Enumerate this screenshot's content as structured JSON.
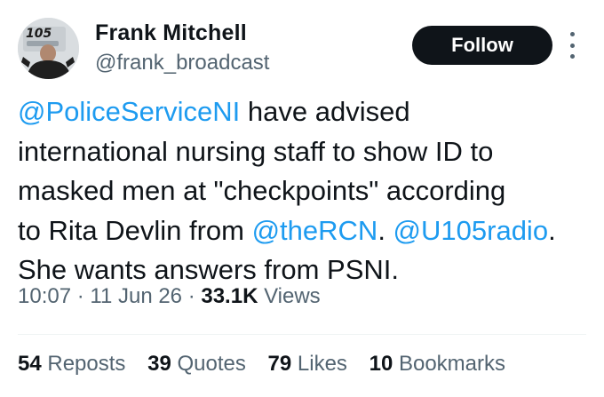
{
  "author": {
    "name": "Frank Mitchell",
    "handle": "@frank_broadcast",
    "avatar_logo_text": "105"
  },
  "follow_label": "Follow",
  "tweet": {
    "line1": {
      "mention": "@PoliceServiceNI",
      "text": " have advised"
    },
    "line2": "international nursing staff to show ID to",
    "line3": "masked men at \"checkpoints\" according",
    "line4": {
      "text": "to Rita Devlin from ",
      "mention1": "@theRCN",
      "sep": ". ",
      "mention2": "@U105radio",
      "end": "."
    },
    "line5": "She wants answers from PSNI."
  },
  "meta": {
    "time": "10:07",
    "sep1": " · ",
    "date": "11 Jun 26",
    "sep2": " · ",
    "views_count": "33.1K",
    "views_label": " Views"
  },
  "stats": {
    "reposts_count": "54",
    "reposts_label": " Reposts",
    "quotes_count": "39",
    "quotes_label": " Quotes",
    "likes_count": "79",
    "likes_label": " Likes",
    "bookmarks_count": "10",
    "bookmarks_label": " Bookmarks"
  },
  "colors": {
    "link": "#1d9bf0",
    "text_primary": "#0f1419",
    "text_secondary": "#536471",
    "follow_bg": "#0f1419"
  }
}
